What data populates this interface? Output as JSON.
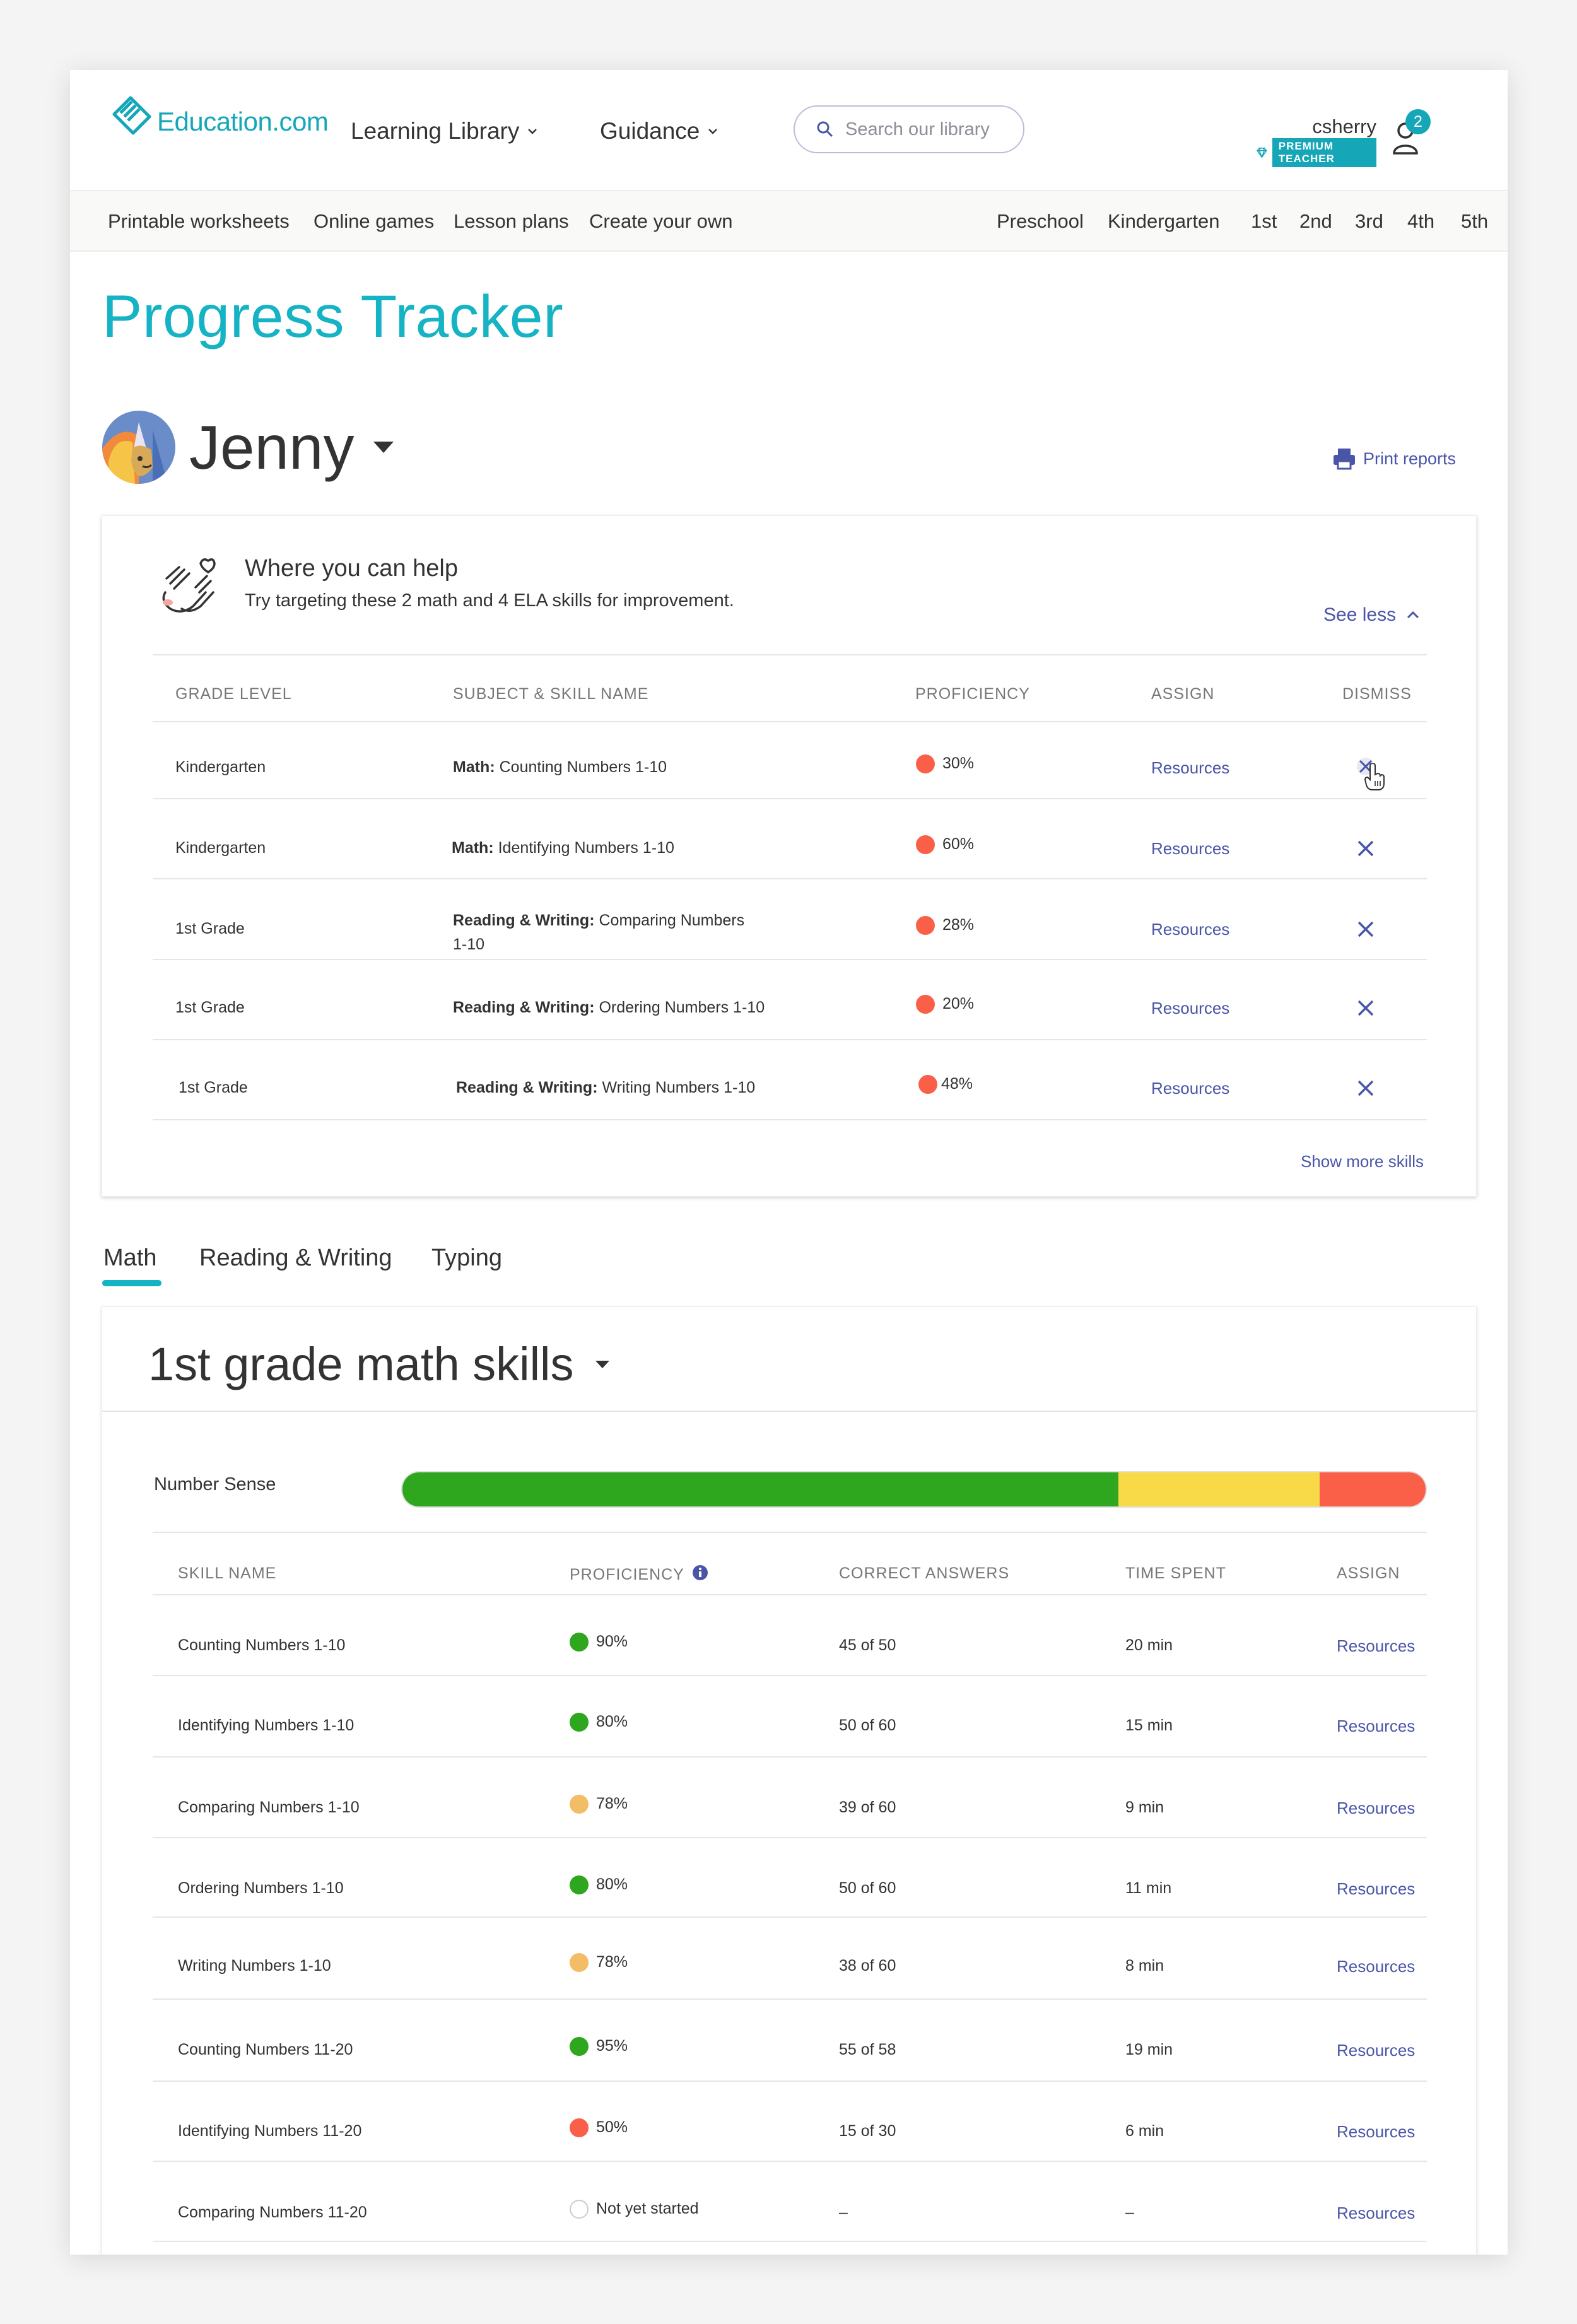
{
  "header": {
    "logo_text": "Education.com",
    "nav": [
      {
        "label": "Learning Library"
      },
      {
        "label": "Guidance"
      }
    ],
    "search_placeholder": "Search our library",
    "user": {
      "name": "csherry",
      "badge": "PREMIUM TEACHER",
      "notifications": "2"
    },
    "brand_color": "#15a7b8"
  },
  "subnav": {
    "left": [
      "Printable worksheets",
      "Online games",
      "Lesson plans",
      "Create your own"
    ],
    "right": [
      "Preschool",
      "Kindergarten",
      "1st",
      "2nd",
      "3rd",
      "4th",
      "5th"
    ]
  },
  "page": {
    "title": "Progress Tracker",
    "student": "Jenny",
    "print_label": "Print reports"
  },
  "help": {
    "title": "Where you can help",
    "subtitle": "Try targeting these 2 math and 4 ELA skills for improvement.",
    "see_less": "See less",
    "columns": [
      "GRADE LEVEL",
      "SUBJECT & SKILL NAME",
      "PROFICIENCY",
      "ASSIGN",
      "DISMISS"
    ],
    "rows": [
      {
        "grade": "Kindergarten",
        "subject": "Math:",
        "skill": "Counting Numbers 1-10",
        "proficiency": "30%",
        "status": "red",
        "assign": "Resources"
      },
      {
        "grade": "Kindergarten",
        "subject": "Math:",
        "skill": "Identifying Numbers 1-10",
        "proficiency": "60%",
        "status": "red",
        "assign": "Resources"
      },
      {
        "grade": "1st Grade",
        "subject": "Reading & Writing:",
        "skill": "Comparing Numbers",
        "skill_line2": "1-10",
        "proficiency": "28%",
        "status": "red",
        "assign": "Resources"
      },
      {
        "grade": "1st Grade",
        "subject": "Reading & Writing:",
        "skill": "Ordering Numbers 1-10",
        "proficiency": "20%",
        "status": "red",
        "assign": "Resources"
      },
      {
        "grade": "1st Grade",
        "subject": "Reading & Writing:",
        "skill": "Writing Numbers 1-10",
        "proficiency": "48%",
        "status": "red",
        "assign": "Resources"
      }
    ],
    "show_more": "Show more skills"
  },
  "tabs": [
    {
      "label": "Math",
      "active": true
    },
    {
      "label": "Reading & Writing",
      "active": false
    },
    {
      "label": "Typing",
      "active": false
    }
  ],
  "skills": {
    "title": "1st grade math skills",
    "category": "Number Sense",
    "progress": {
      "green": 0.703,
      "yellow": 0.198,
      "red": 0.104,
      "empty": 0.058
    },
    "columns": [
      "SKILL NAME",
      "PROFICIENCY",
      "CORRECT ANSWERS",
      "TIME SPENT",
      "ASSIGN"
    ],
    "rows": [
      {
        "name": "Counting Numbers 1-10",
        "proficiency": "90%",
        "status": "green",
        "correct": "45 of 50",
        "time": "20 min",
        "assign": "Resources"
      },
      {
        "name": "Identifying Numbers 1-10",
        "proficiency": "80%",
        "status": "green",
        "correct": "50 of 60",
        "time": "15 min",
        "assign": "Resources"
      },
      {
        "name": "Comparing Numbers 1-10",
        "proficiency": "78%",
        "status": "yellow",
        "correct": "39 of 60",
        "time": "9 min",
        "assign": "Resources"
      },
      {
        "name": "Ordering Numbers 1-10",
        "proficiency": "80%",
        "status": "green",
        "correct": "50 of 60",
        "time": "11 min",
        "assign": "Resources"
      },
      {
        "name": "Writing Numbers 1-10",
        "proficiency": "78%",
        "status": "yellow",
        "correct": "38 of 60",
        "time": "8 min",
        "assign": "Resources"
      },
      {
        "name": "Counting Numbers 11-20",
        "proficiency": "95%",
        "status": "green",
        "correct": "55 of 58",
        "time": "19 min",
        "assign": "Resources"
      },
      {
        "name": "Identifying Numbers 11-20",
        "proficiency": "50%",
        "status": "red",
        "correct": "15 of 30",
        "time": "6 min",
        "assign": "Resources"
      },
      {
        "name": "Comparing Numbers 11-20",
        "proficiency": "Not yet started",
        "status": "empty",
        "correct": "–",
        "time": "–",
        "assign": "Resources"
      }
    ]
  },
  "colors": {
    "green": "#2ea61e",
    "yellow": "#f8d947",
    "red": "#fa5f47",
    "amber": "#f2bd66",
    "link": "#4a55a8",
    "accent": "#15b3c4"
  }
}
